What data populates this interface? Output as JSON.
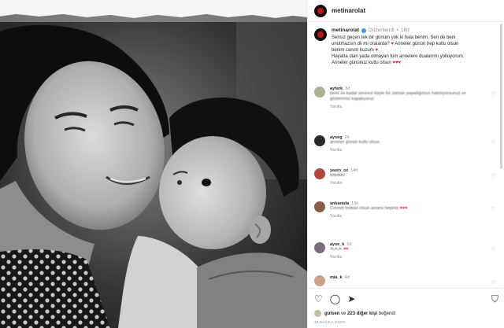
{
  "photo": {
    "alt": ""
  },
  "post": {
    "username": "metinarolat",
    "edited_label": "Düzenlendi",
    "separator": "•",
    "age": "18d",
    "caption_lines": [
      "Sensiz geçen tek bir günüm yok ki hala benim. Sen de beni",
      "unutmazsın dii mi oralarda?",
      "Anneler günün hep kutlu olsun",
      "benim canım kuzum",
      "Hayatta olan yada olmayan tüm annelere dualarımı yolluyorum.",
      "Anneler gününüz kutlu olsun"
    ],
    "heart_single": "♥",
    "heart_triple": "♥♥♥"
  },
  "comments": [
    {
      "user": "ayferk",
      "age": "3d",
      "text": "birini ne kadar sevince böyle bir zaman yaşadığımızı hatırlıyorsunuz ve gözlerimizi kapatıyoruz",
      "emoji": "🙏",
      "reply": "Yanıtla",
      "color": "#a8b58f"
    },
    {
      "user": "ayseg",
      "age": "2h",
      "text": "anneler günün kutlu olsun",
      "emoji": "♥",
      "reply": "Yanıtla",
      "color": "#2b2b2b"
    },
    {
      "user": "yasin_oz",
      "age": "14h",
      "text": "tebrikler",
      "emoji": "",
      "reply": "Yanıtla",
      "color": "#b0463c"
    },
    {
      "user": "ankarada",
      "age": "15h",
      "text": "Cennet mekan olsun annesi hepiniz",
      "emoji": "♥♥♥",
      "reply": "Yanıtla",
      "color": "#8a5b4a"
    },
    {
      "user": "ayse_k",
      "age": "5d",
      "text": "ᗅᗅᗅ",
      "emoji": "♥♥",
      "reply": "Yanıtla",
      "color": "#7d6d7a"
    },
    {
      "user": "mia_k",
      "age": "4d",
      "text": "",
      "emoji": "",
      "reply": "",
      "color": "#caa28a"
    }
  ],
  "likes": {
    "user": "gulsen",
    "connector": "ve",
    "others": "223 diğer kişi",
    "suffix": "beğendi"
  },
  "date": "18 DAKİKA ÖNCE",
  "icons": [
    "heart-icon",
    "comment-icon",
    "share-icon",
    "bookmark-icon"
  ]
}
